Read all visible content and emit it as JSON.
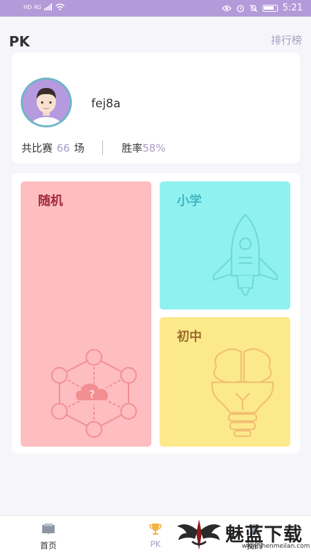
{
  "status_bar": {
    "left_text": "HD 4G",
    "time": "5:21",
    "icons": [
      "signal-icon",
      "wifi-icon",
      "eye-icon",
      "alarm-icon",
      "mute-icon",
      "battery-icon"
    ]
  },
  "header": {
    "title": "PK",
    "leaderboard_link": "排行榜"
  },
  "profile": {
    "username": "fej8a",
    "total_label": "共比赛",
    "total_count": "66",
    "total_unit": "场",
    "winrate_label": "胜率",
    "winrate_value": "58%"
  },
  "modes": {
    "random": {
      "label": "随机"
    },
    "primary": {
      "label": "小学"
    },
    "junior": {
      "label": "初中"
    },
    "random_icon_glyph": "?"
  },
  "tabs": [
    {
      "label": "首页"
    },
    {
      "label": "PK"
    },
    {
      "label": "我的"
    }
  ],
  "watermark": {
    "title": "魅蓝下载",
    "url": "www.shenmeilan.com"
  },
  "colors": {
    "status_bar": "#b39bd9",
    "accent": "#a99bc6",
    "random_bg": "#fdbdc1",
    "primary_bg": "#8ff2f1",
    "junior_bg": "#fce98b"
  }
}
